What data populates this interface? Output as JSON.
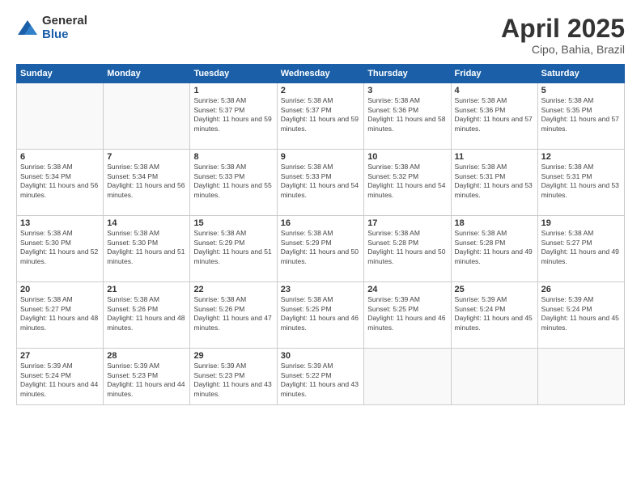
{
  "logo": {
    "general": "General",
    "blue": "Blue"
  },
  "title": "April 2025",
  "subtitle": "Cipo, Bahia, Brazil",
  "weekdays": [
    "Sunday",
    "Monday",
    "Tuesday",
    "Wednesday",
    "Thursday",
    "Friday",
    "Saturday"
  ],
  "weeks": [
    [
      {
        "day": "",
        "info": ""
      },
      {
        "day": "",
        "info": ""
      },
      {
        "day": "1",
        "info": "Sunrise: 5:38 AM\nSunset: 5:37 PM\nDaylight: 11 hours and 59 minutes."
      },
      {
        "day": "2",
        "info": "Sunrise: 5:38 AM\nSunset: 5:37 PM\nDaylight: 11 hours and 59 minutes."
      },
      {
        "day": "3",
        "info": "Sunrise: 5:38 AM\nSunset: 5:36 PM\nDaylight: 11 hours and 58 minutes."
      },
      {
        "day": "4",
        "info": "Sunrise: 5:38 AM\nSunset: 5:36 PM\nDaylight: 11 hours and 57 minutes."
      },
      {
        "day": "5",
        "info": "Sunrise: 5:38 AM\nSunset: 5:35 PM\nDaylight: 11 hours and 57 minutes."
      }
    ],
    [
      {
        "day": "6",
        "info": "Sunrise: 5:38 AM\nSunset: 5:34 PM\nDaylight: 11 hours and 56 minutes."
      },
      {
        "day": "7",
        "info": "Sunrise: 5:38 AM\nSunset: 5:34 PM\nDaylight: 11 hours and 56 minutes."
      },
      {
        "day": "8",
        "info": "Sunrise: 5:38 AM\nSunset: 5:33 PM\nDaylight: 11 hours and 55 minutes."
      },
      {
        "day": "9",
        "info": "Sunrise: 5:38 AM\nSunset: 5:33 PM\nDaylight: 11 hours and 54 minutes."
      },
      {
        "day": "10",
        "info": "Sunrise: 5:38 AM\nSunset: 5:32 PM\nDaylight: 11 hours and 54 minutes."
      },
      {
        "day": "11",
        "info": "Sunrise: 5:38 AM\nSunset: 5:31 PM\nDaylight: 11 hours and 53 minutes."
      },
      {
        "day": "12",
        "info": "Sunrise: 5:38 AM\nSunset: 5:31 PM\nDaylight: 11 hours and 53 minutes."
      }
    ],
    [
      {
        "day": "13",
        "info": "Sunrise: 5:38 AM\nSunset: 5:30 PM\nDaylight: 11 hours and 52 minutes."
      },
      {
        "day": "14",
        "info": "Sunrise: 5:38 AM\nSunset: 5:30 PM\nDaylight: 11 hours and 51 minutes."
      },
      {
        "day": "15",
        "info": "Sunrise: 5:38 AM\nSunset: 5:29 PM\nDaylight: 11 hours and 51 minutes."
      },
      {
        "day": "16",
        "info": "Sunrise: 5:38 AM\nSunset: 5:29 PM\nDaylight: 11 hours and 50 minutes."
      },
      {
        "day": "17",
        "info": "Sunrise: 5:38 AM\nSunset: 5:28 PM\nDaylight: 11 hours and 50 minutes."
      },
      {
        "day": "18",
        "info": "Sunrise: 5:38 AM\nSunset: 5:28 PM\nDaylight: 11 hours and 49 minutes."
      },
      {
        "day": "19",
        "info": "Sunrise: 5:38 AM\nSunset: 5:27 PM\nDaylight: 11 hours and 49 minutes."
      }
    ],
    [
      {
        "day": "20",
        "info": "Sunrise: 5:38 AM\nSunset: 5:27 PM\nDaylight: 11 hours and 48 minutes."
      },
      {
        "day": "21",
        "info": "Sunrise: 5:38 AM\nSunset: 5:26 PM\nDaylight: 11 hours and 48 minutes."
      },
      {
        "day": "22",
        "info": "Sunrise: 5:38 AM\nSunset: 5:26 PM\nDaylight: 11 hours and 47 minutes."
      },
      {
        "day": "23",
        "info": "Sunrise: 5:38 AM\nSunset: 5:25 PM\nDaylight: 11 hours and 46 minutes."
      },
      {
        "day": "24",
        "info": "Sunrise: 5:39 AM\nSunset: 5:25 PM\nDaylight: 11 hours and 46 minutes."
      },
      {
        "day": "25",
        "info": "Sunrise: 5:39 AM\nSunset: 5:24 PM\nDaylight: 11 hours and 45 minutes."
      },
      {
        "day": "26",
        "info": "Sunrise: 5:39 AM\nSunset: 5:24 PM\nDaylight: 11 hours and 45 minutes."
      }
    ],
    [
      {
        "day": "27",
        "info": "Sunrise: 5:39 AM\nSunset: 5:24 PM\nDaylight: 11 hours and 44 minutes."
      },
      {
        "day": "28",
        "info": "Sunrise: 5:39 AM\nSunset: 5:23 PM\nDaylight: 11 hours and 44 minutes."
      },
      {
        "day": "29",
        "info": "Sunrise: 5:39 AM\nSunset: 5:23 PM\nDaylight: 11 hours and 43 minutes."
      },
      {
        "day": "30",
        "info": "Sunrise: 5:39 AM\nSunset: 5:22 PM\nDaylight: 11 hours and 43 minutes."
      },
      {
        "day": "",
        "info": ""
      },
      {
        "day": "",
        "info": ""
      },
      {
        "day": "",
        "info": ""
      }
    ]
  ]
}
